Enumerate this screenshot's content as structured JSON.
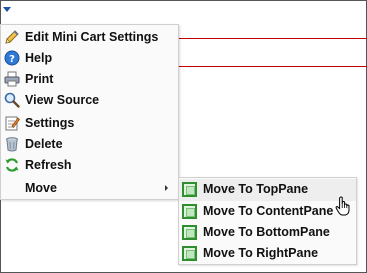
{
  "menu": {
    "items": [
      {
        "label": "Edit Mini Cart Settings",
        "icon": "pencil-icon"
      },
      {
        "label": "Help",
        "icon": "help-icon"
      },
      {
        "label": "Print",
        "icon": "printer-icon"
      },
      {
        "label": "View Source",
        "icon": "magnifier-icon"
      },
      {
        "label": "Settings",
        "icon": "settings-icon"
      },
      {
        "label": "Delete",
        "icon": "trash-icon"
      },
      {
        "label": "Refresh",
        "icon": "refresh-icon"
      },
      {
        "label": "Move",
        "icon": ""
      }
    ]
  },
  "submenu": {
    "items": [
      {
        "label": "Move To TopPane",
        "icon": "pane-icon"
      },
      {
        "label": "Move To ContentPane",
        "icon": "pane-icon"
      },
      {
        "label": "Move To BottomPane",
        "icon": "pane-icon"
      },
      {
        "label": "Move To RightPane",
        "icon": "pane-icon"
      }
    ]
  },
  "colors": {
    "accent_blue": "#1f4fa8",
    "rule_red": "#c00000",
    "pane_green": "#2f8f2f"
  }
}
